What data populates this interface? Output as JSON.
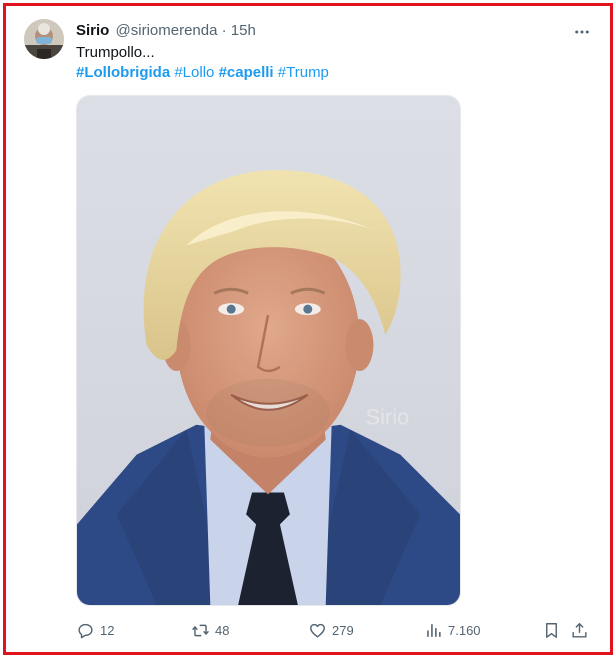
{
  "tweet": {
    "author_name": "Sirio",
    "handle": "@siriomerenda",
    "separator": "·",
    "time": "15h",
    "text": "Trumpollo...",
    "hashtags": [
      {
        "text": "#Lollobrigida",
        "bold": true
      },
      {
        "text": "#Lollo",
        "bold": false
      },
      {
        "text": "#capelli",
        "bold": true
      },
      {
        "text": "#Trump",
        "bold": false
      }
    ],
    "media_watermark": "Sirio"
  },
  "actions": {
    "replies": "12",
    "retweets": "48",
    "likes": "279",
    "views": "7.160"
  },
  "icons": {
    "more": "more-horizontal-icon",
    "reply": "reply-icon",
    "retweet": "retweet-icon",
    "like": "heart-icon",
    "views": "views-chart-icon",
    "bookmark": "bookmark-icon",
    "share": "share-icon"
  },
  "colors": {
    "frame_border": "#e0141e",
    "hashtag": "#1d9bf0",
    "secondary_text": "#536471",
    "primary_text": "#0f1419"
  }
}
